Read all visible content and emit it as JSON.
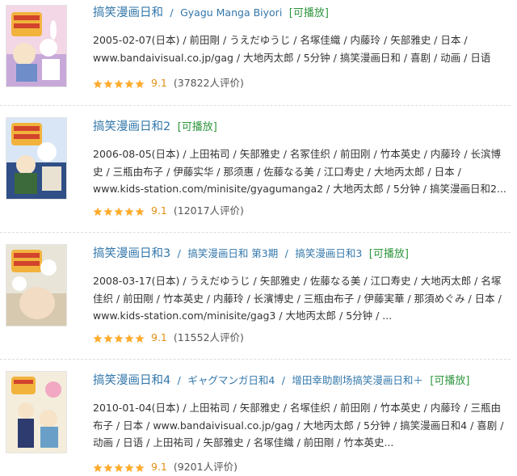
{
  "items": [
    {
      "title": "搞笑漫画日和",
      "alt_titles": [
        "Gyagu Manga Biyori"
      ],
      "playable": "[可播放]",
      "meta": "2005-02-07(日本) / 前田剛 / うえだゆうじ / 名塚佳織 / 内藤玲 / 矢部雅史 / 日本 / www.bandaivisual.co.jp/gag / 大地丙太郎 / 5分钟 / 搞笑漫画日和 / 喜剧 / 动画 / 日语",
      "rating": 9.1,
      "stars": 4.5,
      "score": "9.1",
      "votes": "(37822人评价)"
    },
    {
      "title": "搞笑漫画日和2",
      "alt_titles": [],
      "playable": "[可播放]",
      "meta": "2006-08-05(日本) / 上田祐司 / 矢部雅史 / 名冢佳织 / 前田刚 / 竹本英史 / 内藤玲 / 长滨博史 / 三瓶由布子 / 伊藤实华 / 那须惠 / 佐藤なる美 / 江口寿史 / 大地丙太郎 / 日本 / www.kids-station.com/minisite/gyagumanga2 / 大地丙太郎 / 5分钟 / 搞笑漫画日和2...",
      "rating": 9.1,
      "stars": 4.5,
      "score": "9.1",
      "votes": "(12017人评价)"
    },
    {
      "title": "搞笑漫画日和3",
      "alt_titles": [
        "搞笑漫画日和 第3期",
        "搞笑漫画日和3"
      ],
      "playable": "[可播放]",
      "meta": "2008-03-17(日本) / うえだゆうじ / 矢部雅史 / 佐藤なる美 / 江口寿史 / 大地丙太郎 / 名塚佳织 / 前田剛 / 竹本英史 / 内藤玲 / 长濱博史 / 三瓶由布子 / 伊藤実華 / 那須めぐみ / 日本 / www.kids-station.com/minisite/gag3 / 大地丙太郎 / 5分钟 / ...",
      "rating": 9.1,
      "stars": 4.5,
      "score": "9.1",
      "votes": "(11552人评价)"
    },
    {
      "title": "搞笑漫画日和4",
      "alt_titles": [
        "ギャグマンガ日和4",
        "增田幸助剧场搞笑漫画日和＋"
      ],
      "playable": "[可播放]",
      "meta": "2010-01-04(日本) / 上田祐司 / 矢部雅史 / 名塚佳织 / 前田刚 / 竹本英史 / 内藤玲 / 三瓶由布子 / 日本 / www.bandaivisual.co.jp/gag / 大地丙太郎 / 5分钟 / 搞笑漫画日和4 / 喜剧 / 动画 / 日语 / 上田祐司 / 矢部雅史 / 名塚佳織 / 前田剛 / 竹本英史...",
      "rating": 9.1,
      "stars": 4.5,
      "score": "9.1",
      "votes": "(9201人评价)"
    }
  ],
  "colors": {
    "link": "#3377aa",
    "playable": "#2e963d",
    "star": "#ffac2d",
    "score": "#e09015"
  },
  "icons": {
    "rating": "star-icon"
  }
}
